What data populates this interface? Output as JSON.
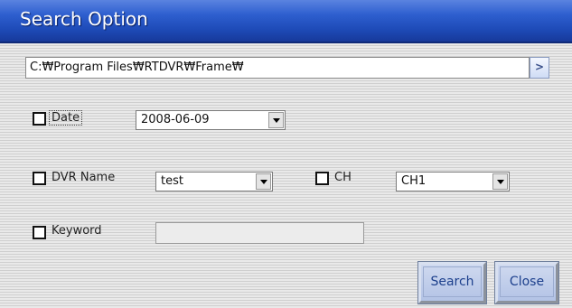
{
  "window": {
    "title": "Search Option"
  },
  "path": {
    "value": "C:₩Program Files₩RTDVR₩Frame₩",
    "browse_label": ">"
  },
  "date": {
    "label": "Date",
    "value": "2008-06-09"
  },
  "dvr": {
    "label": "DVR Name",
    "value": "test"
  },
  "ch": {
    "label": "CH",
    "value": "CH1"
  },
  "keyword": {
    "label": "Keyword",
    "value": ""
  },
  "buttons": {
    "search": "Search",
    "close": "Close"
  }
}
